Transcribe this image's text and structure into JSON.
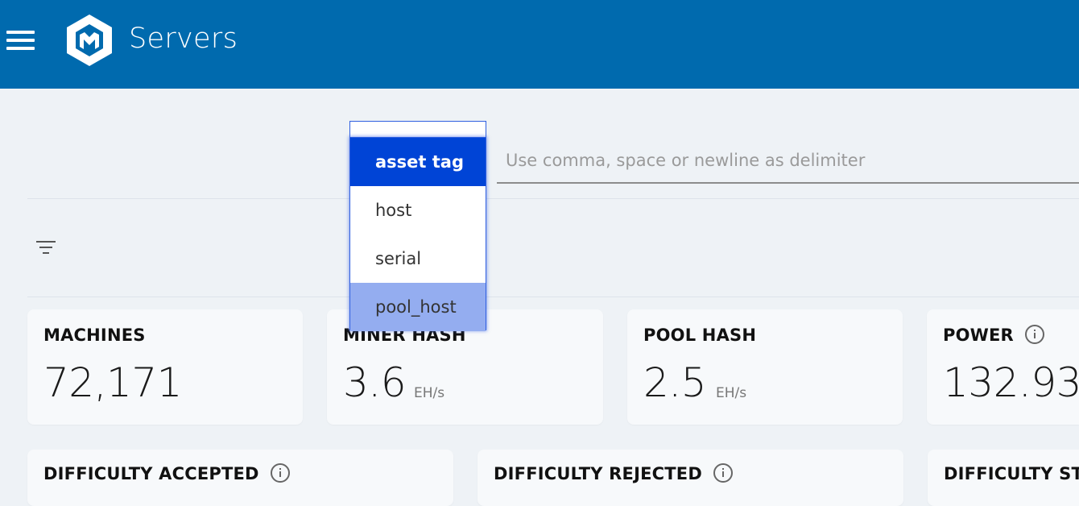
{
  "header": {
    "title": "Servers",
    "menu_icon": "hamburger-menu-icon",
    "logo_icon": "hexagon-m-logo",
    "background": "#006aae"
  },
  "search": {
    "field_options": [
      "asset tag",
      "host",
      "serial",
      "pool_host"
    ],
    "selected_option": "asset tag",
    "hovered_option": "pool_host",
    "placeholder": "Use comma, space or newline as delimiter",
    "value": ""
  },
  "filter": {
    "icon": "filter-icon"
  },
  "stats": {
    "machines": {
      "title": "MACHINES",
      "value": "72,171"
    },
    "miner_hash": {
      "title": "MINER HASH",
      "value": "3.6",
      "unit": "EH/s"
    },
    "pool_hash": {
      "title": "POOL HASH",
      "value": "2.5",
      "unit": "EH/s"
    },
    "power": {
      "title": "POWER",
      "value": "132.93",
      "icon": "info-icon"
    }
  },
  "difficulty": {
    "accepted": {
      "title": "DIFFICULTY ACCEPTED",
      "icon": "info-icon"
    },
    "rejected": {
      "title": "DIFFICULTY REJECTED",
      "icon": "info-icon"
    },
    "stale": {
      "title": "DIFFICULTY STA"
    }
  },
  "colors": {
    "selected_option_bg": "#0044d6",
    "hovered_option_bg": "#94adf0",
    "page_bg": "#eef2f6"
  }
}
